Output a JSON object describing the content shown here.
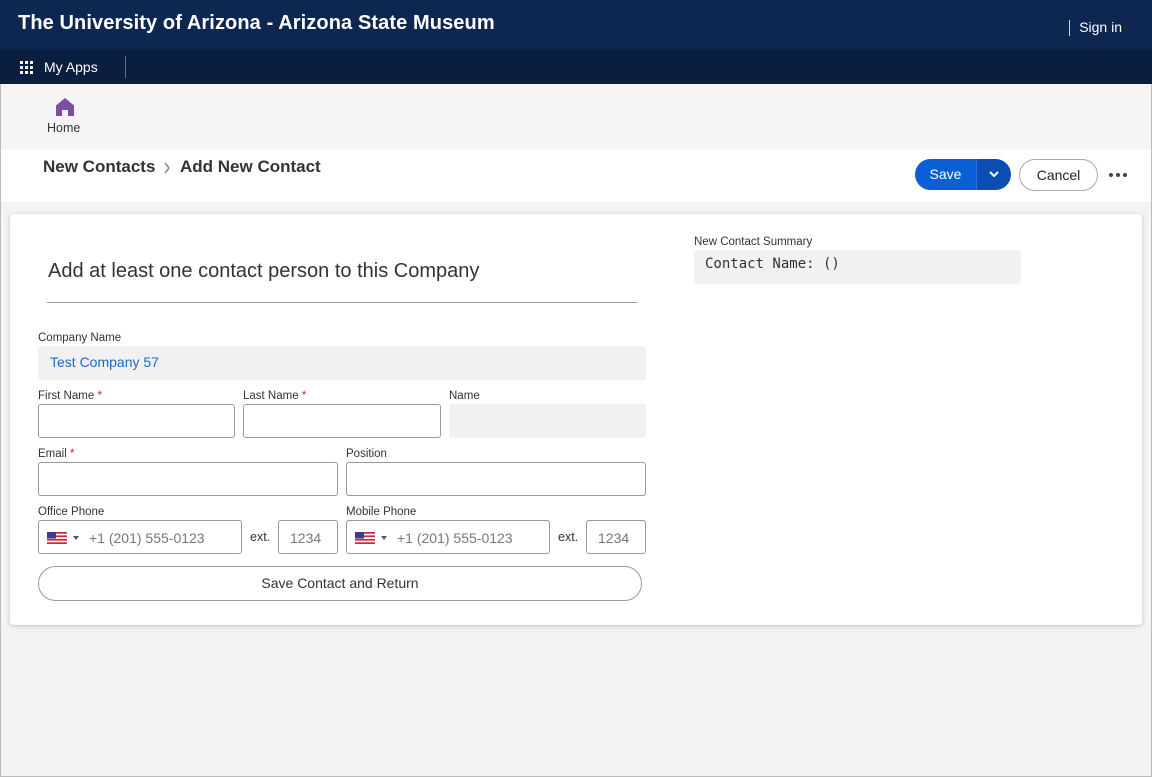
{
  "topbar": {
    "title": "The University of Arizona - Arizona State Museum",
    "sign_in": "Sign in"
  },
  "appbar": {
    "apps_label": "My Apps",
    "apps_icon": "grid-icon"
  },
  "nav": {
    "home_label": "Home",
    "home_icon": "home-icon",
    "home_color": "#7a4fa8"
  },
  "header": {
    "breadcrumb_parent": "New Contacts",
    "breadcrumb_separator": ">",
    "breadcrumb_current": "Add New Contact",
    "save_label": "Save",
    "cancel_label": "Cancel",
    "more_icon": "more-horizontal-icon"
  },
  "form": {
    "heading": "Add at least one contact person to this Company",
    "company_name": {
      "label": "Company Name",
      "value": "Test Company 57"
    },
    "first_name": {
      "label": "First Name",
      "required": "*",
      "value": ""
    },
    "last_name": {
      "label": "Last Name",
      "required": "*",
      "value": ""
    },
    "name": {
      "label": "Name",
      "value": ""
    },
    "email": {
      "label": "Email",
      "required": "*",
      "value": ""
    },
    "position": {
      "label": "Position",
      "value": ""
    },
    "office_phone": {
      "label": "Office Phone",
      "placeholder": "+1 (201) 555-0123",
      "ext_label": "ext.",
      "ext_placeholder": "1234",
      "country": "us-flag-icon"
    },
    "mobile_phone": {
      "label": "Mobile Phone",
      "placeholder": "+1 (201) 555-0123",
      "ext_label": "ext.",
      "ext_placeholder": "1234",
      "country": "us-flag-icon"
    },
    "save_return_label": "Save Contact and Return"
  },
  "summary": {
    "label": "New Contact Summary",
    "value": "Contact Name: ()"
  },
  "colors": {
    "topbar": "#0d2750",
    "appbar": "#0a1f40",
    "primary": "#0b5fd6",
    "link": "#1b6ac9",
    "required": "#d0271d"
  }
}
